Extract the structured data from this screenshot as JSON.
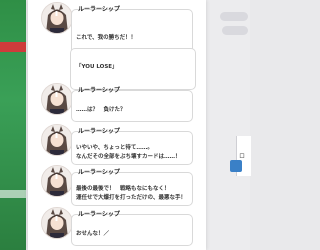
{
  "colors": {
    "panel": "#ffffff",
    "accent_green": "#2f8f46",
    "text": "#333333"
  },
  "messages": [
    {
      "name": "ルーラーシップ",
      "text": "これで、我の勝ちだ！！"
    },
    {
      "name": "",
      "text": "「YOU LOSE」"
    },
    {
      "name": "ルーラーシップ",
      "text": "……は？　負けた？"
    },
    {
      "name": "ルーラーシップ",
      "text": "いやいや、ちょっと待て……。\nなんだその全部をぶち壊すカードは……！"
    },
    {
      "name": "ルーラーシップ",
      "text": "最後の最後で！　戦略もなにもなく！\n運任せで大爆打を打っただけの、最悪な手！"
    },
    {
      "name": "ルーラーシップ",
      "text": "おせんな！／"
    }
  ],
  "side": {
    "label": "ロ"
  }
}
